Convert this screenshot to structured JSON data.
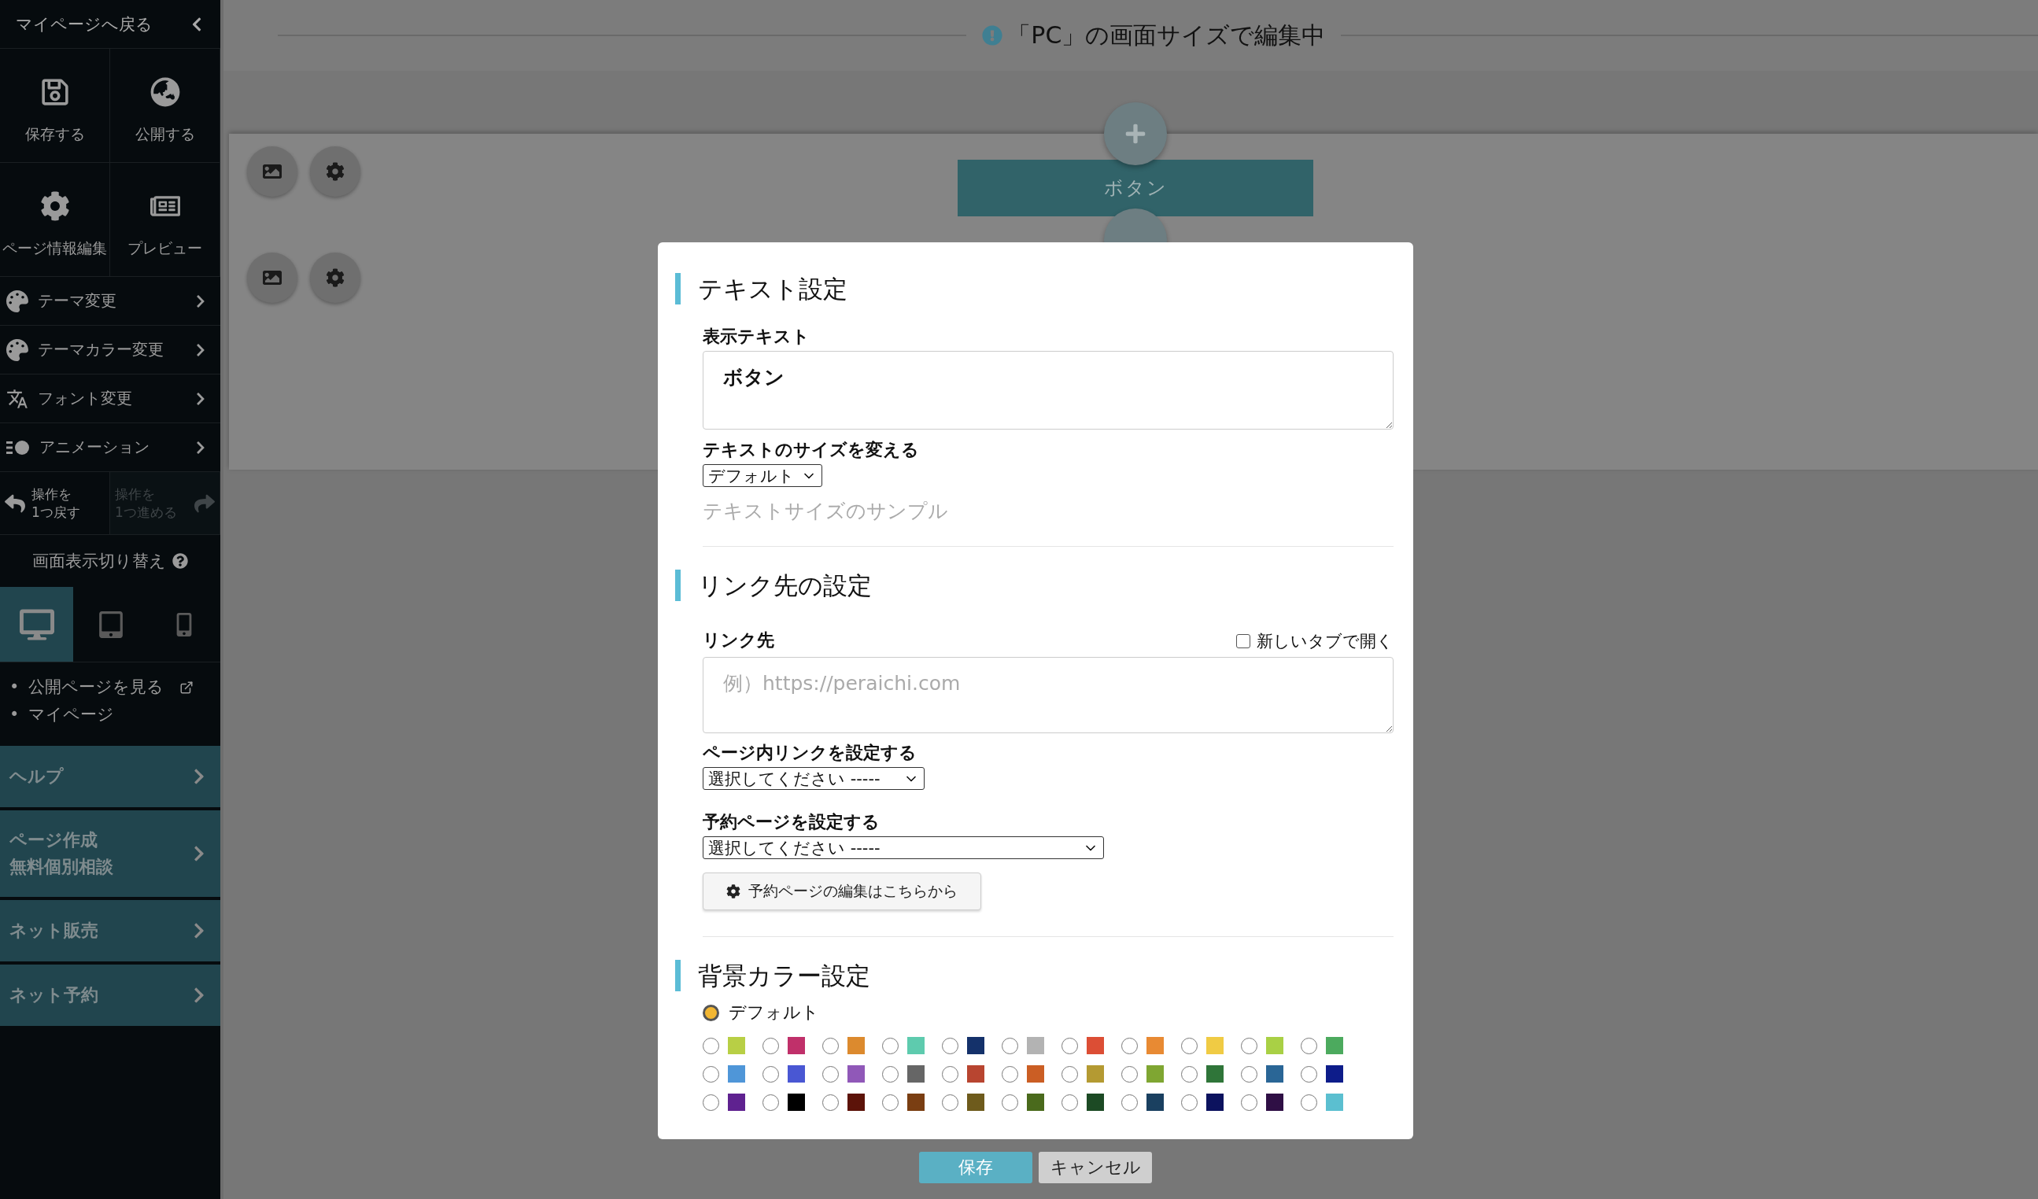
{
  "sidebar": {
    "back_link": "マイページへ戻る",
    "tiles": [
      {
        "kind": "save",
        "label": "保存する"
      },
      {
        "kind": "publish",
        "label": "公開する"
      },
      {
        "kind": "settings",
        "label": "ページ情報編集"
      },
      {
        "kind": "preview",
        "label": "プレビュー"
      }
    ],
    "menu": [
      {
        "kind": "theme",
        "label": "テーマ変更"
      },
      {
        "kind": "color",
        "label": "テーマカラー変更"
      },
      {
        "kind": "font",
        "label": "フォント変更"
      },
      {
        "kind": "animation",
        "label": "アニメーション"
      }
    ],
    "history": [
      {
        "kind": "undo",
        "label": "操作を\n1つ戻す",
        "disabled": false
      },
      {
        "kind": "redo",
        "label": "操作を\n1つ進める",
        "disabled": true
      }
    ],
    "display_switch": {
      "label": "画面表示切り替え",
      "devices": [
        {
          "kind": "desktop",
          "selected": true
        },
        {
          "kind": "tablet",
          "selected": false
        },
        {
          "kind": "mobile",
          "selected": false
        }
      ]
    },
    "links": [
      {
        "bullet": "•",
        "label": "公開ページを見る",
        "external": true
      },
      {
        "bullet": "•",
        "label": "マイページ",
        "external": false
      }
    ],
    "sections": [
      {
        "lines": [
          "ヘルプ"
        ]
      },
      {
        "lines": [
          "ページ作成",
          "無料個別相談"
        ]
      },
      {
        "lines": [
          "ネット販売"
        ]
      },
      {
        "lines": [
          "ネット予約"
        ]
      }
    ]
  },
  "editing_banner": "「PC」の画面サイズで編集中",
  "canvas": {
    "button_label": "ボタン"
  },
  "modal": {
    "text_settings": {
      "title": "テキスト設定",
      "display_text": {
        "label": "表示テキスト",
        "value": "ボタン"
      },
      "size": {
        "label": "テキストのサイズを変える",
        "value": "デフォルト"
      },
      "sample": "テキストサイズのサンプル"
    },
    "link_settings": {
      "title": "リンク先の設定",
      "link": {
        "label": "リンク先",
        "placeholder": "例）https://peraichi.com"
      },
      "new_tab": {
        "label": "新しいタブで開く",
        "checked": false
      },
      "page_link": {
        "label": "ページ内リンクを設定する",
        "value": "選択してください -----"
      },
      "reservation": {
        "label": "予約ページを設定する",
        "value": "選択してください -----"
      },
      "edit_button": "予約ページの編集はこちらから"
    },
    "background": {
      "title": "背景カラー設定",
      "default": {
        "label": "デフォルト",
        "selected": true
      },
      "colors": [
        {
          "color": "#b8cf45",
          "selected": false
        },
        {
          "color": "#c0306a",
          "selected": false
        },
        {
          "color": "#dc8a2e",
          "selected": false
        },
        {
          "color": "#5ecbae",
          "selected": false
        },
        {
          "color": "#14316a",
          "selected": false
        },
        {
          "color": "#b3b3b3",
          "selected": false
        },
        {
          "color": "#dc4e35",
          "selected": false
        },
        {
          "color": "#e88a33",
          "selected": false
        },
        {
          "color": "#f0cb44",
          "selected": false
        },
        {
          "color": "#a9d045",
          "selected": false
        },
        {
          "color": "#4caa5e",
          "selected": false
        },
        {
          "color": "#4f96d8",
          "selected": false
        },
        {
          "color": "#4957d3",
          "selected": false
        },
        {
          "color": "#9058b8",
          "selected": false
        },
        {
          "color": "#666666",
          "selected": false
        },
        {
          "color": "#b84530",
          "selected": false
        },
        {
          "color": "#cb5e24",
          "selected": false
        },
        {
          "color": "#b49a32",
          "selected": false
        },
        {
          "color": "#7fa632",
          "selected": false
        },
        {
          "color": "#2f7539",
          "selected": false
        },
        {
          "color": "#2a6696",
          "selected": false
        },
        {
          "color": "#0d1c8a",
          "selected": false
        },
        {
          "color": "#5f2290",
          "selected": false
        },
        {
          "color": "#000000",
          "selected": false
        },
        {
          "color": "#5c1309",
          "selected": false
        },
        {
          "color": "#7a3e12",
          "selected": false
        },
        {
          "color": "#6e5b1c",
          "selected": false
        },
        {
          "color": "#4a6a1c",
          "selected": false
        },
        {
          "color": "#1c4a24",
          "selected": false
        },
        {
          "color": "#1a4060",
          "selected": false
        },
        {
          "color": "#0c125e",
          "selected": false
        },
        {
          "color": "#2f0f45",
          "selected": false
        },
        {
          "color": "#5bbfd0",
          "selected": false
        }
      ]
    }
  },
  "footer_buttons": [
    {
      "kind": "primary",
      "label": "保存"
    },
    {
      "kind": "secondary",
      "label": "キャンセル"
    }
  ]
}
